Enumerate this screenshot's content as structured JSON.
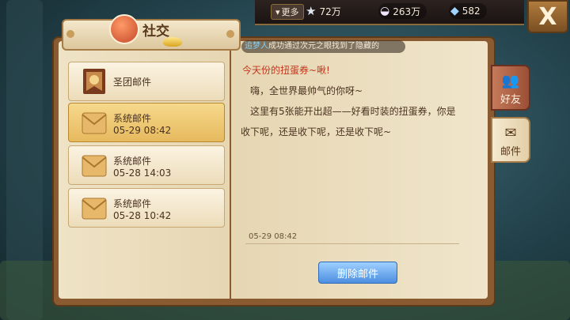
{
  "header": {
    "title": "社交",
    "more_label": "更多",
    "resources": [
      {
        "icon": "star-icon",
        "value": "72万"
      },
      {
        "icon": "shell-icon",
        "value": "263万"
      },
      {
        "icon": "gem-icon",
        "value": "582"
      }
    ],
    "close_symbol": "X"
  },
  "marquee": {
    "name": "追梦人",
    "text": "成功通过次元之眼找到了隐藏的"
  },
  "mails": [
    {
      "type": "guild",
      "icon": "guild-crest-icon",
      "title": "圣团邮件",
      "date": ""
    },
    {
      "type": "system",
      "icon": "envelope-icon",
      "title": "系统邮件",
      "date": "05-29 08:42",
      "selected": true
    },
    {
      "type": "system",
      "icon": "envelope-icon",
      "title": "系统邮件",
      "date": "05-28 14:03"
    },
    {
      "type": "system",
      "icon": "envelope-icon",
      "title": "系统邮件",
      "date": "05-28 10:42"
    }
  ],
  "message": {
    "title": "今天份的扭蛋券~啾!",
    "line1": "嗨，全世界最帅气的你呀~",
    "line2": "这里有5张能开出超——好看时装的扭蛋券，你是",
    "line3": "收下呢，还是收下呢，还是收下呢~",
    "date": "05-29 08:42",
    "delete_label": "删除邮件"
  },
  "tabs": [
    {
      "label": "好友",
      "icon": "friends-icon"
    },
    {
      "label": "邮件",
      "icon": "mail-icon",
      "active": true
    }
  ],
  "colors": {
    "accent_red": "#c2361e",
    "button_blue": "#4c8ee0",
    "selected_mail": "#e6b95e"
  }
}
